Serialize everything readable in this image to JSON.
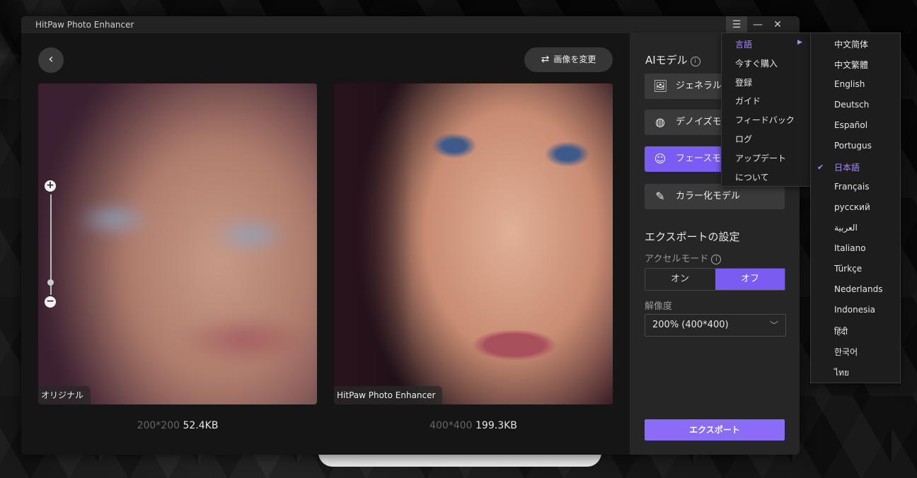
{
  "window": {
    "title": "HitPaw Photo Enhancer",
    "menu_icon": "menu-icon",
    "minimize_icon": "minimize-icon",
    "close_icon": "close-icon"
  },
  "toolbar": {
    "back_icon": "back-arrow-icon",
    "change_image_label": "画像を変更",
    "change_image_icon": "swap-icon"
  },
  "preview": {
    "left_label": "オリジナル",
    "right_label": "HitPaw Photo Enhancer",
    "left_dim": "200*200",
    "left_size": "52.4KB",
    "right_dim": "400*400",
    "right_size": "199.3KB",
    "zoom_plus": "+",
    "zoom_minus": "−"
  },
  "sidebar": {
    "ai_model_title": "AIモデル",
    "info": "i",
    "models": [
      {
        "label": "ジェネラルモ",
        "icon": "image-icon",
        "active": false
      },
      {
        "label": "デノイズモ",
        "icon": "denoise-icon",
        "active": false
      },
      {
        "label": "フェースモ",
        "icon": "face-icon",
        "active": true
      },
      {
        "label": "カラー化モデル",
        "icon": "colorize-icon",
        "active": false
      }
    ],
    "export_settings_title": "エクスポートの設定",
    "accel_label": "アクセルモード",
    "toggle_on": "オン",
    "toggle_off": "オフ",
    "toggle_selected": "オフ",
    "resolution_label": "解像度",
    "resolution_value": "200% (400*400)",
    "export_button": "エクスポート"
  },
  "main_menu": {
    "items": [
      "言語",
      "今すぐ購入",
      "登録",
      "ガイド",
      "フィードバック",
      "ログ",
      "アップデート",
      "について"
    ],
    "selected": "言語"
  },
  "language_menu": {
    "items": [
      "中文简体",
      "中文繁體",
      "English",
      "Deutsch",
      "Español",
      "Portugus",
      "日本語",
      "Français",
      "русский",
      "العربية",
      "Italiano",
      "Türkçe",
      "Nederlands",
      "Indonesia",
      "हिंदी",
      "한국어",
      "ไทย"
    ],
    "selected": "日本語"
  },
  "colors": {
    "accent": "#7b5cf2",
    "accent_text": "#a98bff",
    "panel": "#262626",
    "background": "#151515"
  }
}
